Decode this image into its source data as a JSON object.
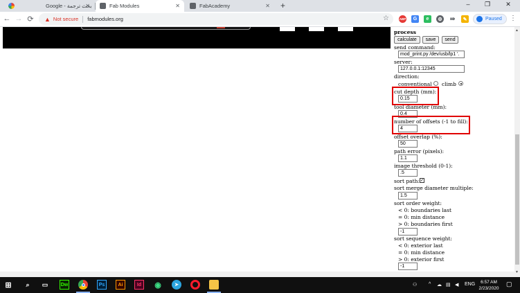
{
  "browser": {
    "tabs": [
      {
        "label": "Google - بحث ترجمة",
        "active": false
      },
      {
        "label": "Fab Modules",
        "active": true
      },
      {
        "label": "FabAcademy",
        "active": false
      }
    ],
    "new_tab": "+",
    "window_controls": {
      "minimize": "–",
      "maximize": "❐",
      "close": "✕"
    },
    "nav": {
      "back": "←",
      "forward": "→",
      "reload": "C"
    },
    "security_label": "Not secure",
    "url": "fabmodules.org",
    "profile_status": "Paused",
    "icons": [
      "ABP",
      "translate-icon",
      "evernote-icon",
      "gear-icon",
      "forward-icon",
      "note-icon",
      "fx-icon"
    ]
  },
  "panel": {
    "heading": "process",
    "buttons": {
      "calculate": "calculate",
      "save": "save",
      "send": "send"
    },
    "send_command_label": "send command:",
    "send_command_value": "mod_print.py /dev/usb/lp1 '.",
    "server_label": "server:",
    "server_value": "127.0.0.1:12345",
    "direction_label": "direction:",
    "direction_options": {
      "conventional": "conventional",
      "climb": "climb"
    },
    "direction_selected": "climb",
    "cut_depth_label": "cut depth (mm):",
    "cut_depth_value": "0.15",
    "tool_diameter_label": "tool diameter (mm):",
    "tool_diameter_value": "0.4",
    "offsets_label": "number of offsets (-1 to fill):",
    "offsets_value": "4",
    "overlap_label": "offset overlap (%):",
    "overlap_value": "50",
    "path_error_label": "path error (pixels):",
    "path_error_value": "1.1",
    "threshold_label": "image threshold (0-1):",
    "threshold_value": ".5",
    "sort_path_label": "sort path:",
    "sort_path_checked": true,
    "merge_label": "sort merge diameter multiple:",
    "merge_value": "1.5",
    "order_label": "sort order weight:",
    "order_lines": [
      "< 0: boundaries last",
      "= 0: min distance",
      "> 0: boundaries first"
    ],
    "order_value": "-1",
    "sequence_label": "sort sequence weight:",
    "sequence_lines": [
      "< 0: exterior last",
      "= 0: min distance",
      "> 0: exterior first"
    ],
    "sequence_value": "-1"
  },
  "taskbar": {
    "apps": [
      "Dw",
      "Ps",
      "Ai",
      "Id"
    ],
    "language": "ENG",
    "time": "6:57 AM",
    "date": "2/23/2020",
    "colors": {
      "dw": "#35fa00",
      "ps": "#31a8ff",
      "ai": "#ff9a00",
      "id": "#ff3366"
    }
  }
}
